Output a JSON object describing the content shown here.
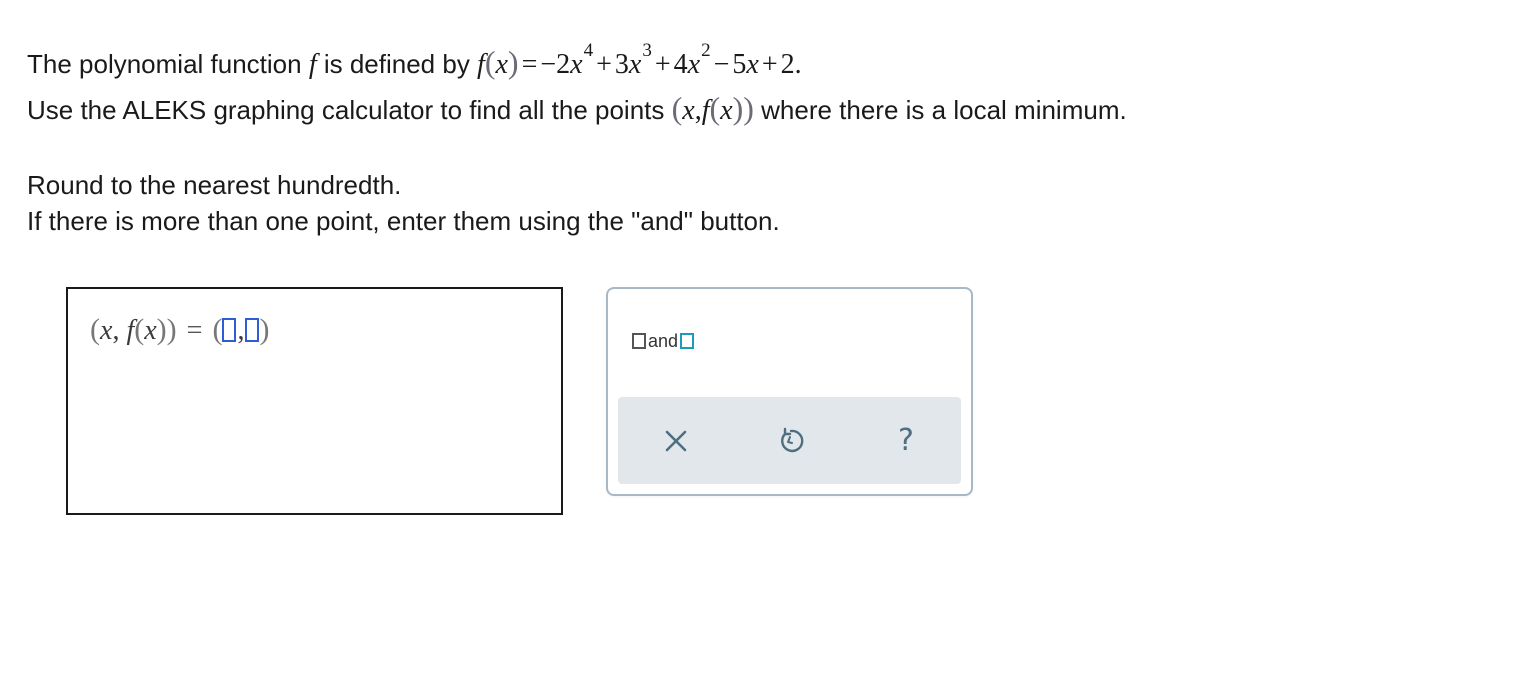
{
  "question": {
    "line1_prefix": "The polynomial function ",
    "f_symbol": "f",
    "line1_mid": " is defined by ",
    "equation": {
      "f": "f",
      "x": "x",
      "lparen": "(",
      "rparen": ")",
      "equals": "=",
      "t1_coef": "−2",
      "t1_exp": "4",
      "plus1": "+",
      "t2_coef": "3",
      "t2_exp": "3",
      "plus2": "+",
      "t3_coef": "4",
      "t3_exp": "2",
      "minus": "−",
      "t4": "5",
      "plus3": "+",
      "const": "2",
      "period": "."
    },
    "line2_prefix": "Use the ALEKS graphing calculator to find all the points ",
    "point_expr": {
      "lparen": "(",
      "x": "x",
      "comma": ",",
      "f": "f",
      "inner_l": "(",
      "inner_x": "x",
      "inner_r": ")",
      "rparen": ")"
    },
    "line2_suffix": " where there is a local minimum.",
    "line3": "Round to the nearest hundredth.",
    "line4": "If there is more than one point, enter them using the \"and\" button."
  },
  "answer": {
    "lhs_lparen": "(",
    "lhs_x": "x",
    "lhs_comma": ",",
    "lhs_f": "f",
    "lhs_inner_l": "(",
    "lhs_inner_x": "x",
    "lhs_inner_r": "))",
    "equals": "=",
    "rhs_lparen": "(",
    "rhs_comma": ",",
    "rhs_rparen": ")"
  },
  "palette": {
    "and_label": "and",
    "clear_icon": "close-x-icon",
    "undo_icon": "undo-icon",
    "help_icon": "question-mark-icon",
    "help_glyph": "?"
  },
  "colors": {
    "slot_border": "#2f5dd8",
    "and_box_accent": "#1c9bbd",
    "action_bar_bg": "#e1e7eb",
    "action_icon": "#4f6f80"
  }
}
